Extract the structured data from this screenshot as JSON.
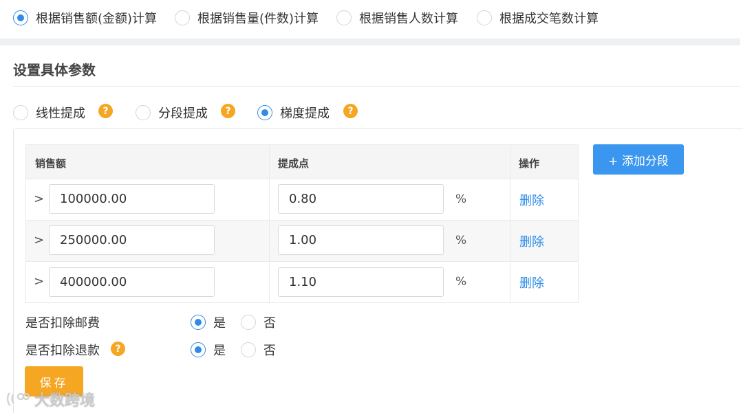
{
  "calc_basis": {
    "options": [
      {
        "label": "根据销售额(金额)计算",
        "checked": true
      },
      {
        "label": "根据销售量(件数)计算",
        "checked": false
      },
      {
        "label": "根据销售人数计算",
        "checked": false
      },
      {
        "label": "根据成交笔数计算",
        "checked": false
      }
    ]
  },
  "params": {
    "title": "设置具体参数"
  },
  "commission_type": {
    "options": [
      {
        "label": "线性提成",
        "checked": false,
        "help": "?"
      },
      {
        "label": "分段提成",
        "checked": false,
        "help": "?"
      },
      {
        "label": "梯度提成",
        "checked": true,
        "help": "?"
      }
    ]
  },
  "table": {
    "headers": [
      "销售额",
      "提成点",
      "操作"
    ],
    "rows": [
      {
        "prefix": ">",
        "sales": "100000.00",
        "rate": "0.80",
        "unit": "%",
        "action": "删除"
      },
      {
        "prefix": ">",
        "sales": "250000.00",
        "rate": "1.00",
        "unit": "%",
        "action": "删除"
      },
      {
        "prefix": ">",
        "sales": "400000.00",
        "rate": "1.10",
        "unit": "%",
        "action": "删除"
      }
    ]
  },
  "add_segment": {
    "label": "+ 添加分段"
  },
  "deduct_shipping": {
    "label": "是否扣除邮费",
    "yes": "是",
    "no": "否",
    "selected": "是"
  },
  "deduct_refund": {
    "label": "是否扣除退款",
    "help": "?",
    "yes": "是",
    "no": "否",
    "selected": "是"
  },
  "save": {
    "label": "保存"
  },
  "watermark": {
    "text": "大数跨境"
  },
  "colors": {
    "primary": "#2f8bea",
    "button_blue": "#3a96ee",
    "orange": "#f5a623"
  }
}
